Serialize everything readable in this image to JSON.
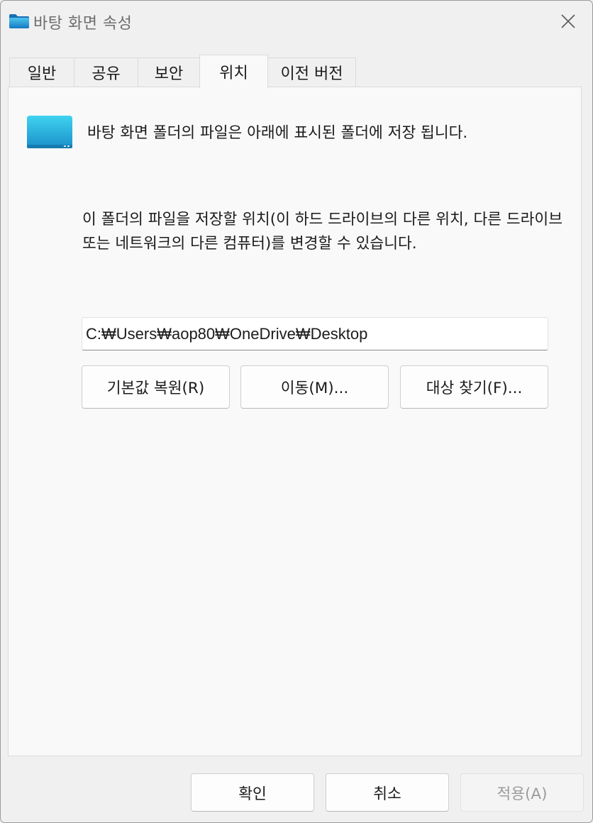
{
  "window": {
    "title": "바탕 화면 속성"
  },
  "tabs": [
    {
      "label": "일반",
      "active": false
    },
    {
      "label": "공유",
      "active": false
    },
    {
      "label": "보안",
      "active": false
    },
    {
      "label": "위치",
      "active": true
    },
    {
      "label": "이전 버전",
      "active": false
    }
  ],
  "location": {
    "description": "바탕 화면 폴더의 파일은 아래에 표시된 폴더에 저장 됩니다.",
    "instruction": "이 폴더의 파일을 저장할 위치(이 하드 드라이브의 다른 위치, 다른 드라이브 또는 네트워크의 다른 컴퓨터)를 변경할 수 있습니다.",
    "path_value": "C:₩Users₩aop80₩OneDrive₩Desktop",
    "restore_default_label": "기본값 복원(R)",
    "move_label": "이동(M)...",
    "find_target_label": "대상 찾기(F)..."
  },
  "footer": {
    "ok_label": "확인",
    "cancel_label": "취소",
    "apply_label": "적용(A)",
    "apply_enabled": false
  },
  "icons": {
    "title": "folder-icon",
    "close": "close-icon",
    "panel": "desktop-folder-icon"
  },
  "colors": {
    "folder_top": "#3fd3f0",
    "folder_bottom": "#1a8fc9",
    "window_bg": "#f0f0f0",
    "panel_bg": "#f9f9f9"
  }
}
